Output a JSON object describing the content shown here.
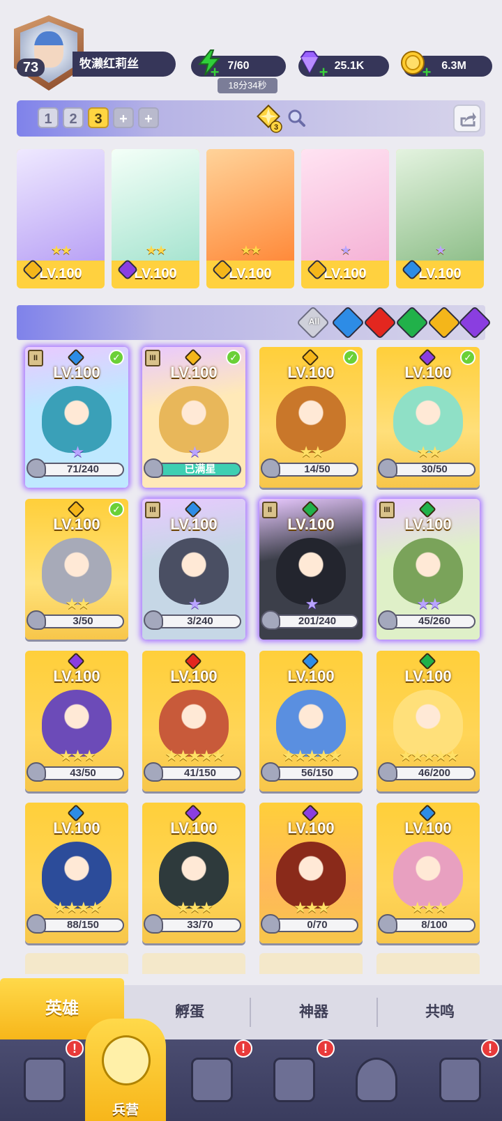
{
  "player": {
    "level": "73",
    "name": "牧濑红莉丝"
  },
  "resources": {
    "energy": "7/60",
    "energy_timer": "18分34秒",
    "gems": "25.1K",
    "gold": "6.3M"
  },
  "team_bar": {
    "team_tabs": [
      "1",
      "2",
      "3"
    ],
    "active_team": "3",
    "add_label": "+",
    "power_badge": "3"
  },
  "team_slots": [
    {
      "level": "LV.100",
      "stars": "★★",
      "element": "light",
      "frame": "gold"
    },
    {
      "level": "LV.100",
      "stars": "★★",
      "element": "dark",
      "frame": "gold"
    },
    {
      "level": "LV.100",
      "stars": "★★",
      "element": "light",
      "frame": "gold"
    },
    {
      "level": "LV.100",
      "stars": "★",
      "element": "light",
      "frame": "silver"
    },
    {
      "level": "LV.100",
      "stars": "★",
      "element": "water",
      "frame": "silver"
    }
  ],
  "filters": {
    "all_label": "All",
    "elements": [
      "water",
      "fire",
      "wind",
      "light",
      "dark"
    ],
    "element_colors": {
      "water": "#2d8ce6",
      "fire": "#e3271f",
      "wind": "#21b14a",
      "light": "#f4b61a",
      "dark": "#8a3ee0"
    }
  },
  "heroes": [
    {
      "level": "LV.100",
      "element": "water",
      "tier": "II",
      "checked": true,
      "stars": "★",
      "star_style": "purple",
      "shards": "71/240",
      "full": false,
      "bg": "#bfe8ff",
      "figure": "#3aa0b8",
      "glow": true
    },
    {
      "level": "LV.100",
      "element": "light",
      "tier": "III",
      "checked": true,
      "stars": "★",
      "star_style": "purple",
      "shards": "已满星",
      "full": true,
      "bg": "#ffe9b8",
      "figure": "#e8b75a",
      "glow": true
    },
    {
      "level": "LV.100",
      "element": "light",
      "tier": "",
      "checked": true,
      "stars": "★★",
      "star_style": "gold",
      "shards": "14/50",
      "full": false,
      "bg": "#ffd76a",
      "figure": "#c9772a",
      "glow": false
    },
    {
      "level": "LV.100",
      "element": "dark",
      "tier": "",
      "checked": true,
      "stars": "★★",
      "star_style": "gold",
      "shards": "30/50",
      "full": false,
      "bg": "#ffdf7a",
      "figure": "#8fe0c6",
      "glow": false
    },
    {
      "level": "LV.100",
      "element": "light",
      "tier": "",
      "checked": true,
      "stars": "★★",
      "star_style": "gold",
      "shards": "3/50",
      "full": false,
      "bg": "#ffe27a",
      "figure": "#a7aab8",
      "glow": false
    },
    {
      "level": "LV.100",
      "element": "water",
      "tier": "III",
      "checked": false,
      "stars": "★",
      "star_style": "purple",
      "shards": "3/240",
      "full": false,
      "bg": "#c6d7e6",
      "figure": "#4a4f63",
      "glow": true
    },
    {
      "level": "LV.100",
      "element": "wind",
      "tier": "II",
      "checked": false,
      "stars": "★",
      "star_style": "purple",
      "shards": "201/240",
      "full": false,
      "bg": "#3c3f4a",
      "figure": "#23252e",
      "glow": true
    },
    {
      "level": "LV.100",
      "element": "wind",
      "tier": "III",
      "checked": false,
      "stars": "★★",
      "star_style": "purple",
      "shards": "45/260",
      "full": false,
      "bg": "#dff0c8",
      "figure": "#7aa35a",
      "glow": true
    },
    {
      "level": "LV.100",
      "element": "dark",
      "tier": "",
      "checked": false,
      "stars": "★★★",
      "star_style": "gold",
      "shards": "43/50",
      "full": false,
      "bg": "#ffd557",
      "figure": "#6c4bb8",
      "glow": false
    },
    {
      "level": "LV.100",
      "element": "fire",
      "tier": "",
      "checked": false,
      "stars": "★★★★★",
      "star_style": "gold",
      "shards": "41/150",
      "full": false,
      "bg": "#ffd557",
      "figure": "#c85a3a",
      "glow": false
    },
    {
      "level": "LV.100",
      "element": "water",
      "tier": "",
      "checked": false,
      "stars": "★★★★★",
      "star_style": "gold",
      "shards": "56/150",
      "full": false,
      "bg": "#ffd557",
      "figure": "#5a8fe0",
      "glow": false
    },
    {
      "level": "LV.100",
      "element": "wind",
      "tier": "",
      "checked": false,
      "stars": "★★★★★",
      "star_style": "gold",
      "shards": "46/200",
      "full": false,
      "bg": "#ffd557",
      "figure": "#ffe07a",
      "glow": false
    },
    {
      "level": "LV.100",
      "element": "water",
      "tier": "",
      "checked": false,
      "stars": "★★★★",
      "star_style": "gold",
      "shards": "88/150",
      "full": false,
      "bg": "#ffd557",
      "figure": "#2c4c9a",
      "glow": false
    },
    {
      "level": "LV.100",
      "element": "dark",
      "tier": "",
      "checked": false,
      "stars": "★★★",
      "star_style": "gold",
      "shards": "33/70",
      "full": false,
      "bg": "#ffd557",
      "figure": "#2e3a3c",
      "glow": false
    },
    {
      "level": "LV.100",
      "element": "dark",
      "tier": "",
      "checked": false,
      "stars": "★★★",
      "star_style": "gold",
      "shards": "0/70",
      "full": false,
      "bg": "#ffb85a",
      "figure": "#8a2a1a",
      "glow": false
    },
    {
      "level": "LV.100",
      "element": "water",
      "tier": "",
      "checked": false,
      "stars": "★★★",
      "star_style": "gold",
      "shards": "8/100",
      "full": false,
      "bg": "#ffd557",
      "figure": "#e8a0c0",
      "glow": false
    }
  ],
  "sub_tabs": [
    "英雄",
    "孵蛋",
    "神器",
    "共鸣"
  ],
  "active_sub_tab": "英雄",
  "nav": {
    "items": [
      "cards",
      "barracks",
      "book",
      "shrine",
      "mushroom",
      "armor"
    ],
    "active_label": "兵营",
    "alerts": [
      "!",
      "!",
      "!",
      "!"
    ]
  }
}
